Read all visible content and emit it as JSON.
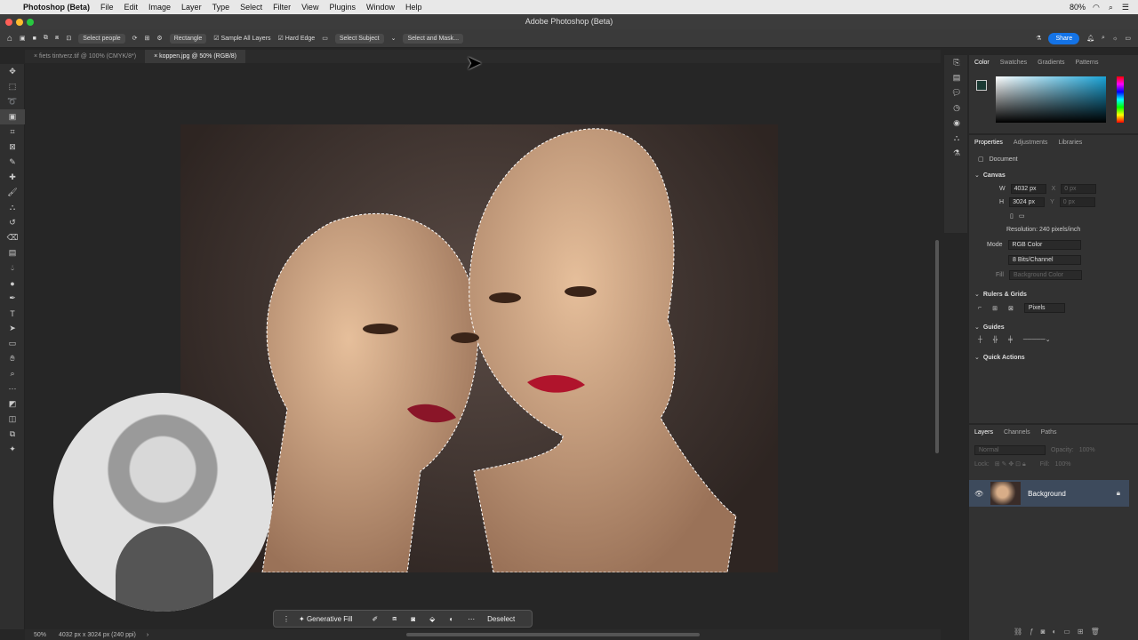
{
  "menubar": {
    "app": "Photoshop (Beta)",
    "items": [
      "File",
      "Edit",
      "Image",
      "Layer",
      "Type",
      "Select",
      "Filter",
      "View",
      "Plugins",
      "Window",
      "Help"
    ],
    "battery": "80%"
  },
  "window_title": "Adobe Photoshop (Beta)",
  "options": {
    "select_people": "Select people",
    "shape": "Rectangle",
    "sample_all_layers": "Sample All Layers",
    "hard_edge": "Hard Edge",
    "select_subject": "Select Subject",
    "select_and_mask": "Select and Mask...",
    "share": "Share"
  },
  "tabs": [
    {
      "label": "fiets tintverz.tif @ 100% (CMYK/8*)"
    },
    {
      "label": "koppen.jpg @ 50% (RGB/8)"
    }
  ],
  "status": {
    "zoom": "50%",
    "info": "4032 px x 3024 px (240 ppi)"
  },
  "contextbar": {
    "generative_fill": "Generative Fill",
    "deselect": "Deselect"
  },
  "color_panel": {
    "tabs": [
      "Color",
      "Swatches",
      "Gradients",
      "Patterns"
    ],
    "active": "Color"
  },
  "properties": {
    "tabs": [
      "Properties",
      "Adjustments",
      "Libraries"
    ],
    "document_label": "Document",
    "canvas_label": "Canvas",
    "w_label": "W",
    "w_value": "4032 px",
    "x_label": "X",
    "x_value": "0 px",
    "h_label": "H",
    "h_value": "3024 px",
    "y_label": "Y",
    "y_value": "0 px",
    "resolution": "Resolution: 240 pixels/inch",
    "mode_label": "Mode",
    "mode_value": "RGB Color",
    "bits_value": "8 Bits/Channel",
    "fill_label": "Fill",
    "fill_value": "Background Color",
    "rulers_label": "Rulers & Grids",
    "units": "Pixels",
    "guides_label": "Guides",
    "quick_actions": "Quick Actions"
  },
  "layers": {
    "tabs": [
      "Layers",
      "Channels",
      "Paths"
    ],
    "blend": "Normal",
    "opacity_label": "Opacity:",
    "opacity": "100%",
    "lock_label": "Lock:",
    "fill_label": "Fill:",
    "fill": "100%",
    "layer_name": "Background"
  }
}
